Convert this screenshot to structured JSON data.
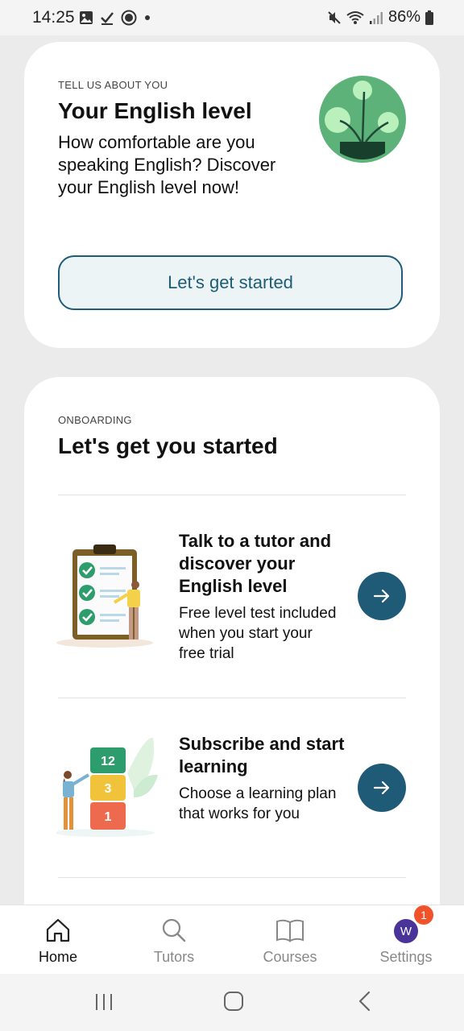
{
  "status_bar": {
    "time": "14:25",
    "battery": "86%"
  },
  "level_card": {
    "eyebrow": "TELL US ABOUT YOU",
    "title": "Your English level",
    "description": "How comfortable are you speaking English? Discover your English level now!",
    "cta_label": "Let's get started"
  },
  "onboarding": {
    "eyebrow": "ONBOARDING",
    "title": "Let's get you started",
    "steps": [
      {
        "title": "Talk to a tutor and discover your English level",
        "description": "Free level test included when you start your free trial",
        "icon": "arrow-right-icon"
      },
      {
        "title": "Subscribe and start learning",
        "description": "Choose a learning plan that works for you",
        "icon": "arrow-right-icon",
        "blocks": [
          "12",
          "3",
          "1"
        ]
      }
    ]
  },
  "bottom_nav": {
    "items": [
      {
        "label": "Home",
        "icon": "home-icon",
        "active": true
      },
      {
        "label": "Tutors",
        "icon": "search-icon",
        "active": false
      },
      {
        "label": "Courses",
        "icon": "book-icon",
        "active": false
      },
      {
        "label": "Settings",
        "icon": "avatar",
        "active": false
      }
    ],
    "avatar_initial": "W",
    "settings_badge": "1"
  },
  "colors": {
    "accent": "#1f5b77",
    "badge": "#f0522a",
    "avatar": "#4a3399"
  }
}
